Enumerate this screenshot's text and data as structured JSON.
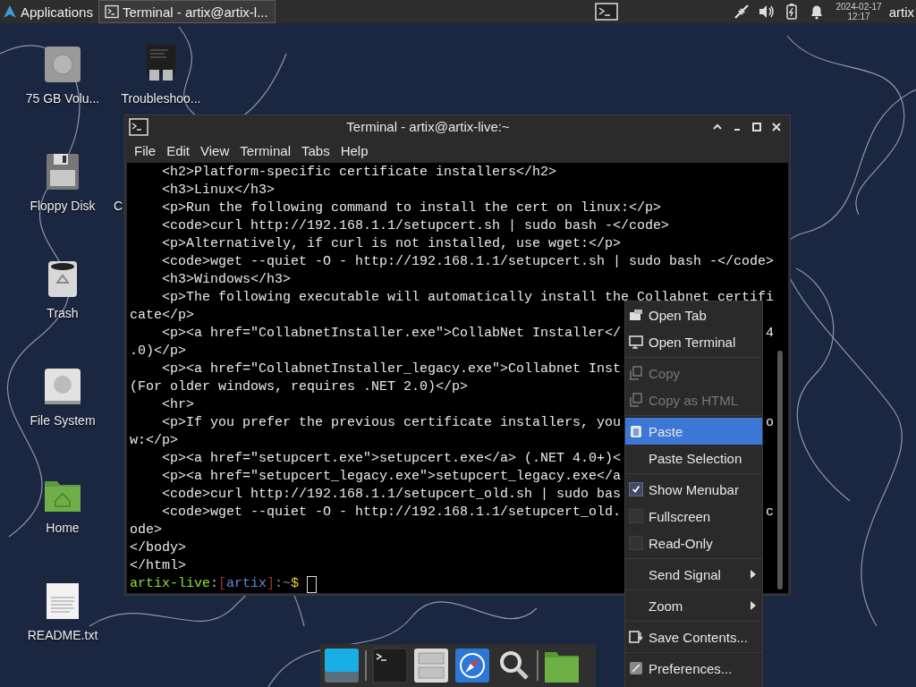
{
  "top_panel": {
    "apps_menu": "Applications",
    "tasks": [
      {
        "title": "Terminal - artix@artix-l...",
        "selected": true
      }
    ],
    "date": "2024-02-17",
    "time": "12:17",
    "user": "artix"
  },
  "desktop_icons": [
    {
      "label": "75 GB Volu..."
    },
    {
      "label": "Troubleshoo..."
    },
    {
      "label": "Floppy Disk"
    },
    {
      "label": "C"
    },
    {
      "label": "Trash"
    },
    {
      "label": "File System"
    },
    {
      "label": "Home"
    },
    {
      "label": "README.txt"
    }
  ],
  "terminal": {
    "title": "Terminal - artix@artix-live:~",
    "menu": [
      "File",
      "Edit",
      "View",
      "Terminal",
      "Tabs",
      "Help"
    ],
    "lines": [
      {
        "text": "    <h2>Platform-specific certificate installers</h2>"
      },
      {
        "text": "    <h3>Linux</h3>"
      },
      {
        "text": "    <p>Run the following command to install the cert on linux:</p>"
      },
      {
        "text": "    <code>curl http://192.168.1.1/setupcert.sh | sudo bash -</code>"
      },
      {
        "text": "    <p>Alternatively, if curl is not installed, use wget:</p>"
      },
      {
        "text": "    <code>wget --quiet -O - http://192.168.1.1/setupcert.sh | sudo bash -</code>"
      },
      {
        "text": "    <h3>Windows</h3>"
      },
      {
        "text": "    <p>The following executable will automatically install the Collabnet certifi"
      },
      {
        "text": "cate</p>"
      },
      {
        "text": "    <p><a href=\"CollabnetInstaller.exe\">CollabNet Installer</",
        "tail": "4"
      },
      {
        "text": ".0)</p>"
      },
      {
        "text": "    <p><a href=\"CollabnetInstaller_legacy.exe\">Collabnet Inst"
      },
      {
        "text": "(For older windows, requires .NET 2.0)</p>"
      },
      {
        "text": "    <hr>"
      },
      {
        "text": "    <p>If you prefer the previous certificate installers, you",
        "tail": "o"
      },
      {
        "text": "w:</p>"
      },
      {
        "text": "    <p><a href=\"setupcert.exe\">setupcert.exe</a> (.NET 4.0+)<"
      },
      {
        "text": "    <p><a href=\"setupcert_legacy.exe\">setupcert_legacy.exe</a"
      },
      {
        "text": "    <code>curl http://192.168.1.1/setupcert_old.sh | sudo bas"
      },
      {
        "text": "    <code>wget --quiet -O - http://192.168.1.1/setupcert_old.",
        "tail": "c"
      },
      {
        "text": "ode>"
      },
      {
        "text": "</body>"
      },
      {
        "text": "</html>"
      }
    ],
    "prompt": [
      {
        "text": "artix-live",
        "color": "#8ae234"
      },
      {
        "text": ":",
        "color": "#b8b8b8"
      },
      {
        "text": "[",
        "color": "#9a3030"
      },
      {
        "text": "artix",
        "color": "#5b8bd8"
      },
      {
        "text": "]",
        "color": "#9a3030"
      },
      {
        "text": ":~",
        "color": "#8a8a8a"
      },
      {
        "text": "$",
        "color": "#e9d040"
      }
    ]
  },
  "context_menu": {
    "items": [
      {
        "kind": "action",
        "label": "Open Tab",
        "disabled": false,
        "selected": false
      },
      {
        "kind": "action",
        "label": "Open Terminal",
        "disabled": false,
        "selected": false
      },
      {
        "kind": "action",
        "label": "Copy",
        "disabled": true,
        "selected": false,
        "separator_before": true
      },
      {
        "kind": "action",
        "label": "Copy as HTML",
        "disabled": true,
        "selected": false
      },
      {
        "kind": "action",
        "label": "Paste",
        "disabled": false,
        "selected": true,
        "separator_before": true
      },
      {
        "kind": "action",
        "label": "Paste Selection",
        "disabled": false,
        "selected": false
      },
      {
        "kind": "check",
        "label": "Show Menubar",
        "checked": true,
        "selected": false,
        "separator_before": true
      },
      {
        "kind": "check",
        "label": "Fullscreen",
        "checked": false,
        "selected": false
      },
      {
        "kind": "check",
        "label": "Read-Only",
        "checked": false,
        "selected": false
      },
      {
        "kind": "submenu",
        "label": "Send Signal",
        "selected": false,
        "separator_before": true
      },
      {
        "kind": "submenu",
        "label": "Zoom",
        "selected": false,
        "separator_before": true
      },
      {
        "kind": "action",
        "label": "Save Contents...",
        "disabled": false,
        "selected": false,
        "separator_before": true
      },
      {
        "kind": "action",
        "label": "Preferences...",
        "disabled": false,
        "selected": false,
        "separator_before": true
      }
    ]
  }
}
